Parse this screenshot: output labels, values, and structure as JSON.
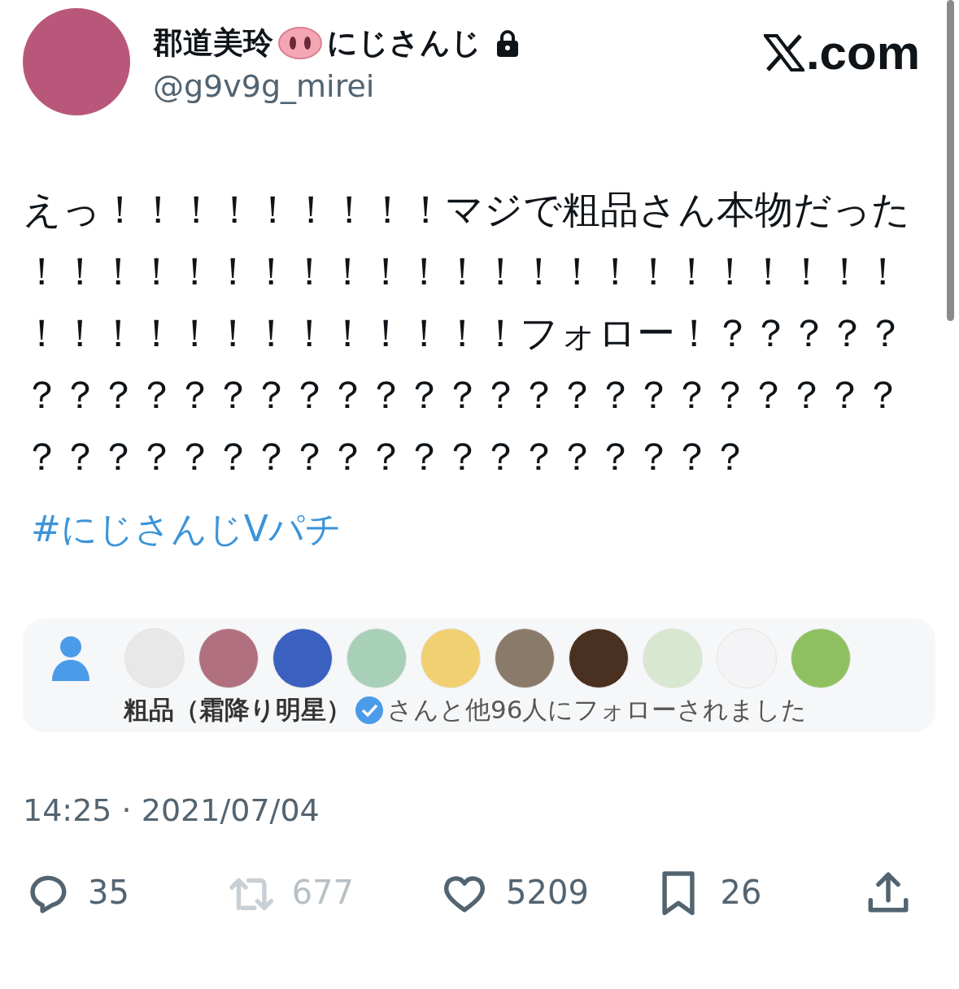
{
  "author": {
    "name": "郡道美玲",
    "name_suffix": "にじさんじ",
    "locked": true,
    "handle": "@g9v9g_mirei"
  },
  "brand": {
    "suffix": ".com"
  },
  "tweet": {
    "text": "えっ！！！！！！！！！マジで粗品さん本物だった！！！！！！！！！！！！！！！！！！！！！！！！！！！！！！！！！！！！フォロー！？？？？？？？？？？？？？？？？？？？？？？？？？？？？？？？？？？？？？？？？？？？？？？？",
    "hashtag": "#にじさんじVパチ"
  },
  "followed_by": {
    "avatars": [
      {
        "color": "#e8e8e8"
      },
      {
        "color": "#b07080"
      },
      {
        "color": "#3a60c0"
      },
      {
        "color": "#a8d0b8"
      },
      {
        "color": "#f0d070"
      },
      {
        "color": "#8a7a6a"
      },
      {
        "color": "#4a3020"
      },
      {
        "color": "#d8e8d0"
      },
      {
        "color": "#f4f4f6"
      },
      {
        "color": "#8fc060"
      }
    ],
    "name": "粗品（霜降り明星）",
    "verified": true,
    "rest": "さんと他96人にフォローされました"
  },
  "timestamp": "14:25 · 2021/07/04",
  "actions": [
    {
      "kind": "reply",
      "count": "35",
      "disabled": false
    },
    {
      "kind": "retweet",
      "count": "677",
      "disabled": true
    },
    {
      "kind": "like",
      "count": "5209",
      "disabled": false
    },
    {
      "kind": "bookmark",
      "count": "26",
      "disabled": false
    },
    {
      "kind": "share",
      "disabled": false
    }
  ]
}
